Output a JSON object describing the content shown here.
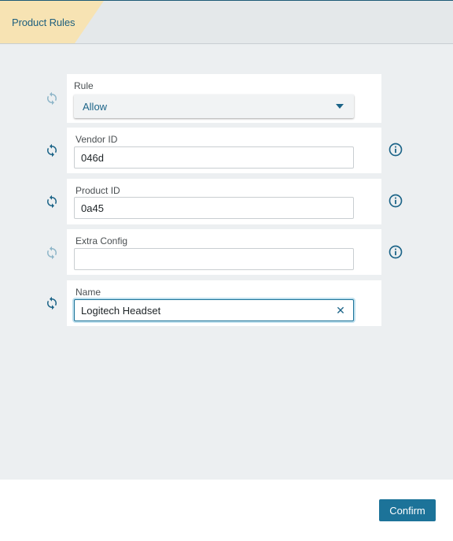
{
  "header": {
    "tab_label": "Product Rules"
  },
  "form": {
    "rule": {
      "label": "Rule",
      "value": "Allow"
    },
    "vendor_id": {
      "label": "Vendor ID",
      "value": "046d"
    },
    "product_id": {
      "label": "Product ID",
      "value": "0a45"
    },
    "extra_config": {
      "label": "Extra Config",
      "value": ""
    },
    "name": {
      "label": "Name",
      "value": "Logitech Headset"
    }
  },
  "footer": {
    "confirm_label": "Confirm"
  },
  "icons": {
    "sync": "sync-icon",
    "info": "info-icon",
    "clear": "clear-icon",
    "dropdown": "chevron-down-icon"
  },
  "colors": {
    "accent": "#1c7399",
    "tab_bg": "#f7e3b3",
    "sync_active": "#1c6488",
    "sync_inactive": "#8fb6c9"
  }
}
